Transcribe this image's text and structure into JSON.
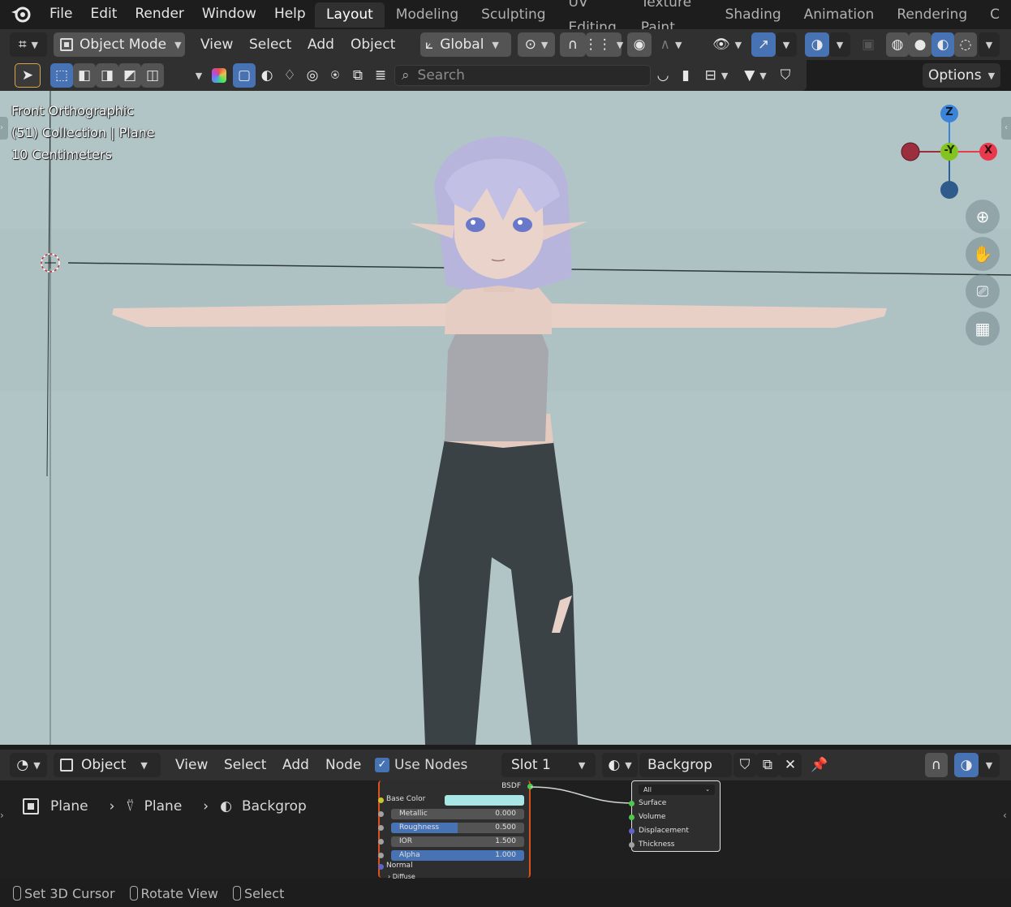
{
  "menu": [
    "File",
    "Edit",
    "Render",
    "Window",
    "Help"
  ],
  "workspaces": [
    "Layout",
    "Modeling",
    "Sculpting",
    "UV Editing",
    "Texture Paint",
    "Shading",
    "Animation",
    "Rendering",
    "C"
  ],
  "header": {
    "mode": "Object Mode",
    "menus": [
      "View",
      "Select",
      "Add",
      "Object"
    ],
    "transform_orientation": "Global"
  },
  "toolbar2": {
    "search_placeholder": "Search",
    "options_label": "Options"
  },
  "viewport": {
    "view_name": "Front Orthographic",
    "collection_info": "(51) Collection | Plane",
    "scale": "10 Centimeters",
    "gizmo": {
      "z": "Z",
      "y": "-Y",
      "x": "X"
    }
  },
  "node_editor": {
    "type": "Object",
    "menus": [
      "View",
      "Select",
      "Add",
      "Node"
    ],
    "use_nodes_label": "Use Nodes",
    "slot": "Slot 1",
    "material": "Backgrop",
    "breadcrumb": [
      "Plane",
      "Plane",
      "Backgrop"
    ],
    "bsdf": {
      "title": "BSDF",
      "base_color_label": "Base Color",
      "base_color": "#a8e7e6",
      "fields": [
        {
          "label": "Metallic",
          "value": "0.000",
          "fill": 0.0
        },
        {
          "label": "Roughness",
          "value": "0.500",
          "fill": 0.5
        },
        {
          "label": "IOR",
          "value": "1.500",
          "fill": 0.0
        },
        {
          "label": "Alpha",
          "value": "1.000",
          "fill": 1.0
        }
      ],
      "normal_label": "Normal",
      "diffuse_label": "Diffuse"
    },
    "output": {
      "target": "All",
      "sockets": [
        "Surface",
        "Volume",
        "Displacement",
        "Thickness"
      ]
    }
  },
  "status": [
    "Set 3D Cursor",
    "Rotate View",
    "Select"
  ],
  "colors": {
    "accent": "#4772b3",
    "viewport_bg": "#b2c5c6",
    "axis_x": "#e8394d",
    "axis_y": "#84c41f",
    "axis_z": "#3b84d8"
  }
}
